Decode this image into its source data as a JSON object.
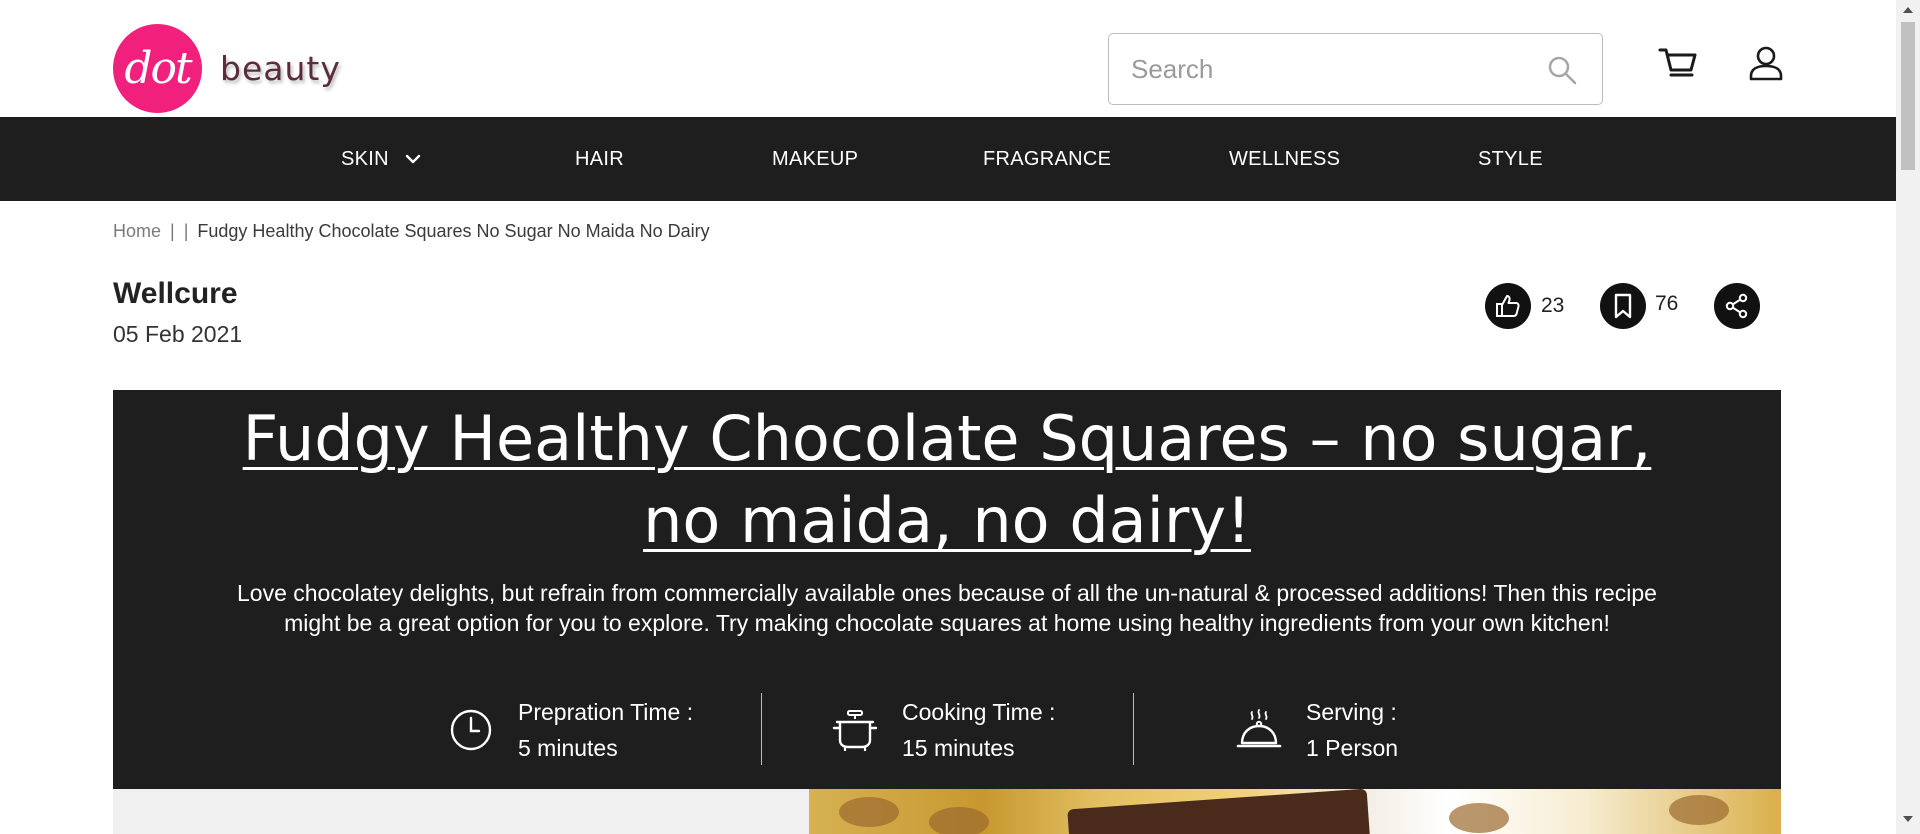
{
  "header": {
    "logo_mark": "dot",
    "logo_text": "beauty",
    "search_placeholder": "Search",
    "icons": [
      "search-icon",
      "cart-icon",
      "user-icon"
    ]
  },
  "nav": {
    "items": [
      "SKIN",
      "HAIR",
      "MAKEUP",
      "FRAGRANCE",
      "WELLNESS",
      "STYLE"
    ]
  },
  "breadcrumb": {
    "home": "Home",
    "separator": "|",
    "current": "Fudgy Healthy Chocolate Squares No Sugar No Maida No Dairy"
  },
  "article": {
    "author": "Wellcure",
    "date": "05 Feb 2021",
    "likes": "23",
    "bookmarks": "76",
    "title": "Fudgy Healthy Chocolate Squares – no sugar, no maida, no dairy!",
    "description": "Love chocolatey delights, but refrain from commercially available ones because of all the un-natural & processed additions! Then this recipe might be a great option for you to explore. Try making chocolate squares at home using healthy ingredients from your own kitchen!",
    "meta": [
      {
        "label": "Prepration Time :",
        "value": "5 minutes",
        "icon": "clock-icon"
      },
      {
        "label": "Cooking Time :",
        "value": "15 minutes",
        "icon": "cooking-pot-icon"
      },
      {
        "label": "Serving :",
        "value": "1 Person",
        "icon": "serving-dish-icon"
      }
    ]
  },
  "colors": {
    "brand_pink": "#f0207c",
    "nav_bg": "#1e1e1e",
    "hero_bg": "#1e1e1e"
  }
}
